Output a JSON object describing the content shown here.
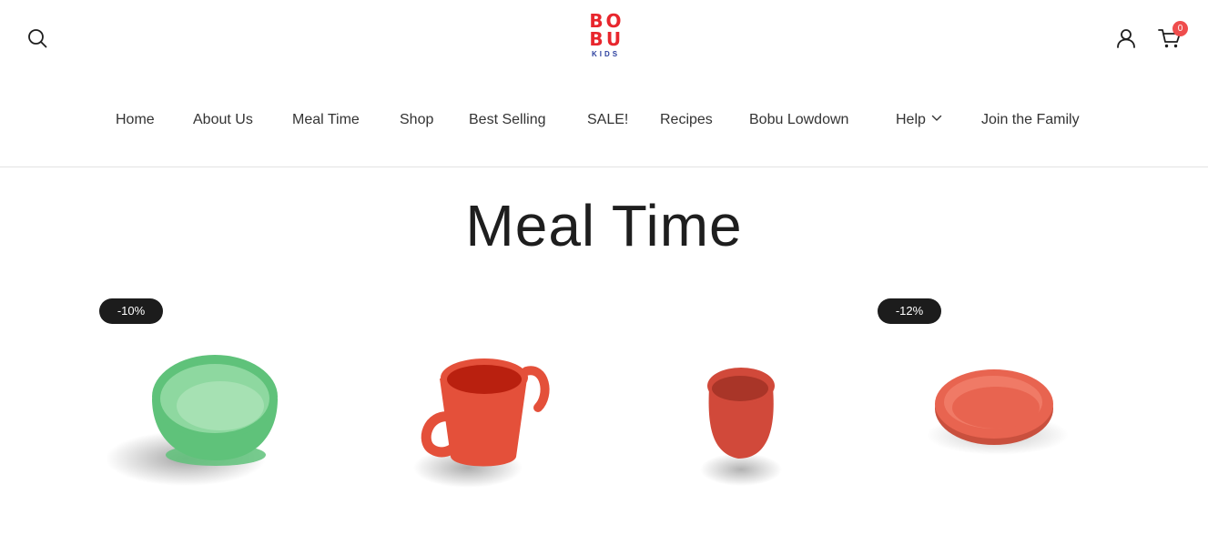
{
  "brand": {
    "logo_letters": [
      "B",
      "O",
      "B",
      "U"
    ],
    "logo_sub": "KIDS",
    "logo_red": "#e8262d",
    "logo_blue": "#2b3f9e"
  },
  "header": {
    "cart_count": "0",
    "cart_badge_color": "#ef4d4d",
    "icons": [
      "search-icon",
      "user-icon",
      "cart-icon"
    ]
  },
  "nav": {
    "items": [
      {
        "label": "Home"
      },
      {
        "label": "About Us"
      },
      {
        "label": "Meal Time"
      },
      {
        "label": "Shop"
      },
      {
        "label": "Best Selling"
      },
      {
        "label": "SALE!"
      },
      {
        "label": "Recipes"
      },
      {
        "label": "Bobu Lowdown"
      },
      {
        "label": "Help"
      },
      {
        "label": "Join the Family"
      }
    ]
  },
  "page": {
    "title": "Meal Time"
  },
  "products": [
    {
      "badge": "-10%",
      "product_color": "#5fc27a",
      "image": "green silicone bowl"
    },
    {
      "badge": "",
      "product_color": "#e4503a",
      "image": "red silicone mug"
    },
    {
      "badge": "",
      "product_color": "#d1493a",
      "image": "red silicone cup"
    },
    {
      "badge": "-12%",
      "product_color": "#e86450",
      "image": "coral silicone plate"
    }
  ],
  "colors": {
    "badge_bg": "#1c1c1c",
    "text": "#222222",
    "divider": "#e3e3e3"
  }
}
